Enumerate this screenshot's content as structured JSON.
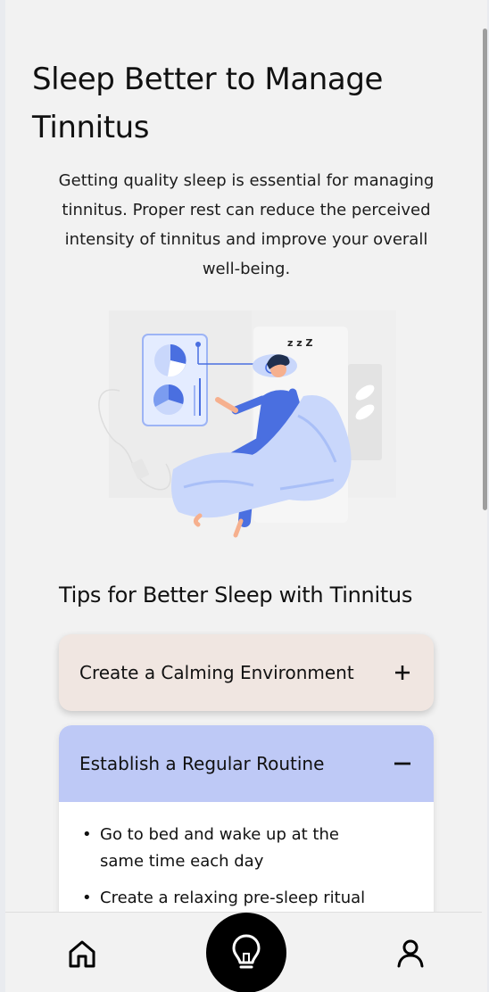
{
  "page": {
    "title": "Sleep Better to Manage Tinnitus",
    "intro": "Getting quality sleep is essential for managing tinnitus. Proper rest can reduce the perceived intensity of tinnitus and improve your overall well-being."
  },
  "illustration": {
    "snore_text": "z z Z"
  },
  "tips": {
    "heading": "Tips for Better Sleep with Tinnitus",
    "items": [
      {
        "title": "Create a Calming Environment",
        "expanded": false,
        "icon": "plus-icon",
        "color": "#f0e6e1",
        "bullets": []
      },
      {
        "title": "Establish a Regular Routine",
        "expanded": true,
        "icon": "minus-icon",
        "color": "#bec9f6",
        "bullets": [
          "Go to bed and wake up at the same time each day",
          "Create a relaxing pre-sleep ritual"
        ]
      }
    ]
  },
  "bullet_glyph": "•",
  "nav": {
    "items": [
      {
        "icon": "home-icon"
      },
      {
        "icon": "lightbulb-icon",
        "active": true
      },
      {
        "icon": "profile-icon"
      }
    ]
  },
  "colors": {
    "background": "#f2f2f2",
    "accent": "#bec9f6",
    "card_rose": "#f0e6e1",
    "nav_active": "#000000",
    "illustration_blue": "#5a84ee"
  }
}
